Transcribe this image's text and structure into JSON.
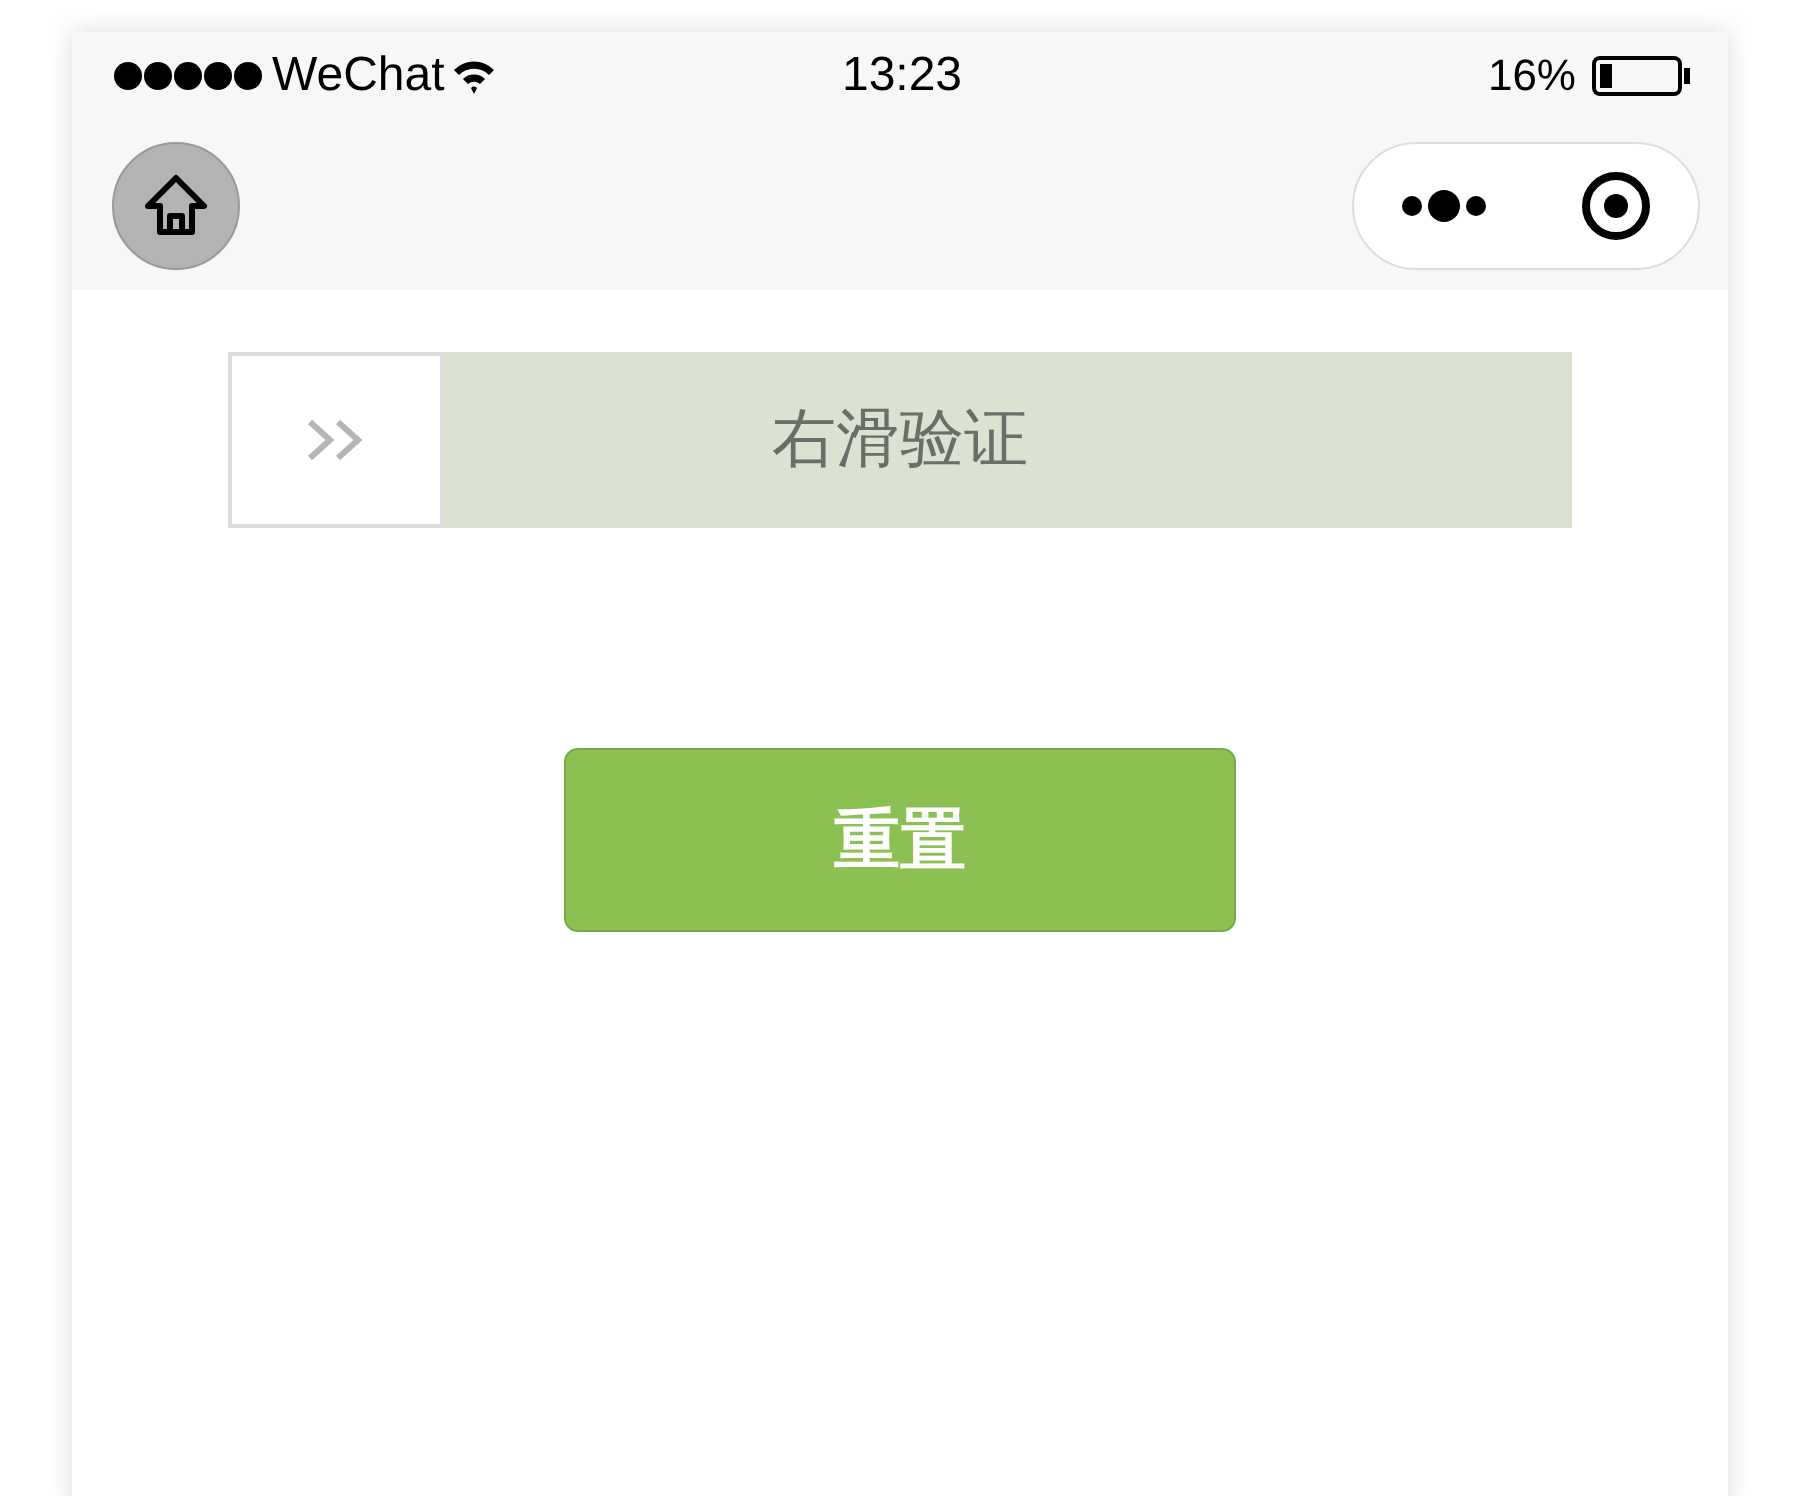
{
  "status_bar": {
    "carrier": "WeChat",
    "time": "13:23",
    "battery": "16%"
  },
  "slider": {
    "label": "右滑验证",
    "level": 0
  },
  "reset_button": {
    "label": "重置"
  }
}
